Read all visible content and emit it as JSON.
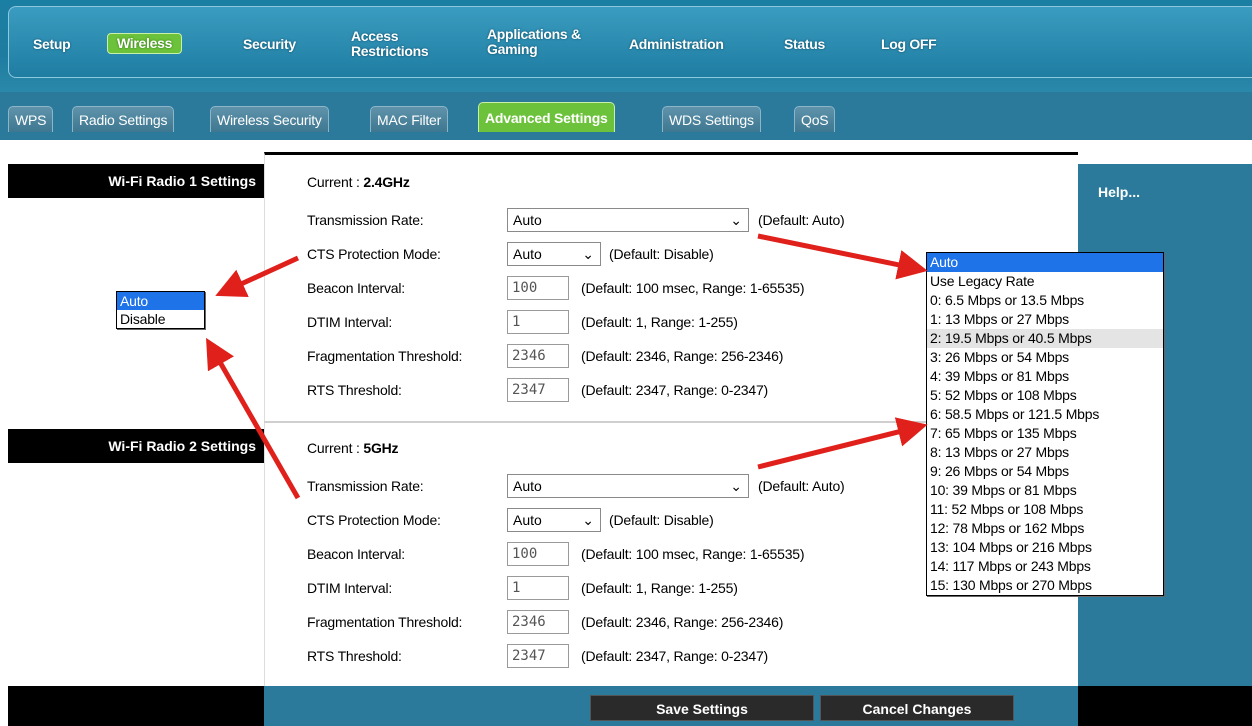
{
  "nav": {
    "items": [
      "Setup",
      "Wireless",
      "Security",
      "Access Restrictions",
      "Applications & Gaming",
      "Administration",
      "Status",
      "Log OFF"
    ]
  },
  "subtabs": [
    "WPS",
    "Radio Settings",
    "Wireless Security",
    "MAC Filter",
    "Advanced Settings",
    "WDS Settings",
    "QoS"
  ],
  "radio1": {
    "section_title": "Wi-Fi Radio 1 Settings",
    "current_label": "Current :",
    "current_value": "2.4GHz",
    "rows": {
      "tx_label": "Transmission Rate:",
      "tx_value": "Auto",
      "tx_default": "(Default: Auto)",
      "cts_label": "CTS Protection Mode:",
      "cts_value": "Auto",
      "cts_default": "(Default: Disable)",
      "beacon_label": "Beacon Interval:",
      "beacon_value": "100",
      "beacon_default": "(Default: 100 msec, Range: 1-65535)",
      "dtim_label": "DTIM Interval:",
      "dtim_value": "1",
      "dtim_default": "(Default: 1, Range: 1-255)",
      "frag_label": "Fragmentation Threshold:",
      "frag_value": "2346",
      "frag_default": "(Default: 2346, Range: 256-2346)",
      "rts_label": "RTS Threshold:",
      "rts_value": "2347",
      "rts_default": "(Default: 2347, Range: 0-2347)"
    }
  },
  "radio2": {
    "section_title": "Wi-Fi Radio 2 Settings",
    "current_label": "Current :",
    "current_value": "5GHz",
    "rows": {
      "tx_label": "Transmission Rate:",
      "tx_value": "Auto",
      "tx_default": "(Default: Auto)",
      "cts_label": "CTS Protection Mode:",
      "cts_value": "Auto",
      "cts_default": "(Default: Disable)",
      "beacon_label": "Beacon Interval:",
      "beacon_value": "100",
      "beacon_default": "(Default: 100 msec, Range: 1-65535)",
      "dtim_label": "DTIM Interval:",
      "dtim_value": "1",
      "dtim_default": "(Default: 1, Range: 1-255)",
      "frag_label": "Fragmentation Threshold:",
      "frag_value": "2346",
      "frag_default": "(Default: 2346, Range: 256-2346)",
      "rts_label": "RTS Threshold:",
      "rts_value": "2347",
      "rts_default": "(Default: 2347, Range: 0-2347)"
    }
  },
  "cts_dropdown": {
    "options": [
      "Auto",
      "Disable"
    ],
    "selected_index": 0
  },
  "rate_dropdown": {
    "options": [
      "Auto",
      "Use Legacy Rate",
      "0: 6.5 Mbps or 13.5 Mbps",
      "1: 13 Mbps or 27 Mbps",
      "2: 19.5 Mbps or 40.5 Mbps",
      "3: 26 Mbps or 54 Mbps",
      "4: 39 Mbps or 81 Mbps",
      "5: 52 Mbps or 108 Mbps",
      "6: 58.5 Mbps or 121.5 Mbps",
      "7: 65 Mbps or 135 Mbps",
      "8: 13 Mbps or 27 Mbps",
      "9: 26 Mbps or 54 Mbps",
      "10: 39 Mbps or 81 Mbps",
      "11: 52 Mbps or 108 Mbps",
      "12: 78 Mbps or 162 Mbps",
      "13: 104 Mbps or 216 Mbps",
      "14: 117 Mbps or 243 Mbps",
      "15: 130 Mbps or 270 Mbps"
    ],
    "selected_index": 0,
    "hover_index": 4
  },
  "help": {
    "label": "Help..."
  },
  "footer": {
    "save_label": "Save Settings",
    "cancel_label": "Cancel Changes"
  },
  "colors": {
    "nav_blue": "#1e7ca0",
    "active_green": "#6cc23a",
    "panel_blue": "#2b7a9c",
    "arrow_red": "#e0201b",
    "select_blue": "#1e73e8"
  },
  "icons": {
    "select_chevron": "chevron-down-icon",
    "annotation": "red-arrow-icon"
  }
}
